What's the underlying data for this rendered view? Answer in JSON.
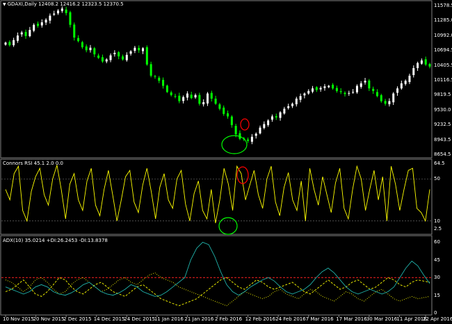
{
  "window": {
    "symbol_label": "GDAXI,Daily",
    "ohlc_label": "12408.2 12416.2 12323.5 12370.5"
  },
  "price_axis": [
    "11578.5",
    "11285.0",
    "10992.0",
    "10694.5",
    "10405.5",
    "10116.5",
    "9819.5",
    "9530.0",
    "9232.5",
    "8943.5",
    "8654.5"
  ],
  "rsi_panel": {
    "title": "Connors RSI 45.1 2.0 0.0",
    "axis": [
      "64.5",
      "50",
      "10",
      "2.5"
    ]
  },
  "adx_panel": {
    "title": "ADX(10) 35.0214 +DI:26.2453 -DI:13.8378",
    "axis": [
      "60",
      "45",
      "30",
      "15",
      "0"
    ]
  },
  "dates": [
    "10 Nov 2015",
    "20 Nov 2015",
    "2 Dec 2015",
    "14 Dec 2015",
    "24 Dec 2015",
    "11 Jan 2016",
    "21 Jan 2016",
    "2 Feb 2016",
    "12 Feb 2016",
    "24 Feb 2016",
    "7 Mar 2016",
    "17 Mar 2016",
    "30 Mar 2016",
    "11 Apr 2016",
    "22 Apr 2016"
  ],
  "colors": {
    "bull": "#ffffff",
    "bear": "#00ff00",
    "rsi": "#ffff00",
    "adx": "#20b2aa",
    "plus_di": "#ffff00",
    "minus_di": "#ffff00",
    "level": "#ff2020",
    "circle_green": "#00ff00",
    "circle_red": "#ff0000"
  },
  "chart_data": {
    "type": "candlestick",
    "closes": [
      10850,
      10800,
      10900,
      10990,
      11050,
      10980,
      11100,
      11200,
      11180,
      11250,
      11300,
      11380,
      11420,
      11480,
      11520,
      11430,
      11200,
      10950,
      10880,
      10760,
      10700,
      10750,
      10620,
      10550,
      10480,
      10520,
      10600,
      10650,
      10580,
      10520,
      10610,
      10680,
      10750,
      10700,
      10740,
      10420,
      10200,
      10180,
      10100,
      10000,
      9880,
      9820,
      9790,
      9700,
      9780,
      9850,
      9760,
      9820,
      9650,
      9680,
      9850,
      9750,
      9650,
      9550,
      9450,
      9400,
      9230,
      9050,
      8960,
      8950,
      8920,
      9000,
      9060,
      9180,
      9250,
      9320,
      9400,
      9380,
      9480,
      9550,
      9600,
      9650,
      9750,
      9800,
      9850,
      9900,
      9950,
      9920,
      9960,
      9990,
      10000,
      9950,
      9900,
      9880,
      9840,
      9860,
      9880,
      10000,
      10050,
      10100,
      9950,
      9900,
      9800,
      9700,
      9650,
      9700,
      9850,
      9950,
      10050,
      10100,
      10200,
      10350,
      10450,
      10500,
      10420,
      10380
    ],
    "rsi": {
      "values": [
        40,
        30,
        55,
        62,
        20,
        10,
        38,
        52,
        60,
        35,
        25,
        50,
        63,
        40,
        12,
        45,
        55,
        30,
        20,
        48,
        60,
        25,
        15,
        40,
        58,
        35,
        10,
        30,
        52,
        58,
        28,
        18,
        44,
        60,
        38,
        12,
        42,
        55,
        30,
        22,
        50,
        58,
        26,
        10,
        36,
        48,
        20,
        12,
        40,
        8,
        30,
        60,
        45,
        20,
        62,
        55,
        30,
        44,
        58,
        35,
        22,
        50,
        62,
        28,
        15,
        42,
        56,
        30,
        20,
        48,
        10,
        60,
        40,
        25,
        52,
        35,
        18,
        46,
        60,
        22,
        12,
        40,
        62,
        50,
        20,
        40,
        58,
        30,
        52,
        10,
        62,
        45,
        20,
        40,
        58,
        60,
        22,
        18,
        10,
        40
      ],
      "levels": [
        10,
        50
      ]
    },
    "adx": {
      "adx": [
        22,
        20,
        18,
        16,
        18,
        22,
        24,
        22,
        18,
        16,
        15,
        17,
        20,
        24,
        26,
        22,
        18,
        16,
        15,
        17,
        20,
        24,
        22,
        18,
        16,
        14,
        15,
        18,
        22,
        26,
        30,
        45,
        55,
        60,
        58,
        48,
        35,
        24,
        18,
        15,
        18,
        22,
        25,
        28,
        30,
        27,
        22,
        18,
        16,
        18,
        20,
        24,
        30,
        35,
        38,
        34,
        28,
        22,
        18,
        16,
        18,
        20,
        18,
        16,
        18,
        22,
        30,
        38,
        44,
        40,
        32,
        25
      ],
      "plus_di": [
        18,
        20,
        24,
        28,
        22,
        16,
        14,
        18,
        24,
        30,
        28,
        22,
        18,
        16,
        20,
        24,
        26,
        22,
        18,
        16,
        14,
        18,
        22,
        24,
        20,
        16,
        12,
        10,
        8,
        6,
        8,
        10,
        12,
        16,
        20,
        24,
        28,
        30,
        26,
        22,
        20,
        24,
        28,
        26,
        22,
        20,
        22,
        24,
        26,
        22,
        18,
        16,
        20,
        24,
        28,
        24,
        20,
        22,
        26,
        28,
        24,
        20,
        22,
        26,
        30,
        28,
        24,
        22,
        26,
        28,
        27,
        26
      ],
      "minus_di": [
        28,
        26,
        22,
        18,
        22,
        28,
        30,
        26,
        20,
        16,
        18,
        24,
        28,
        30,
        26,
        22,
        18,
        20,
        24,
        28,
        30,
        26,
        24,
        28,
        32,
        34,
        30,
        28,
        26,
        22,
        20,
        18,
        16,
        14,
        12,
        10,
        8,
        6,
        10,
        14,
        18,
        16,
        14,
        12,
        14,
        18,
        20,
        16,
        14,
        12,
        16,
        20,
        18,
        14,
        12,
        10,
        14,
        18,
        16,
        12,
        10,
        14,
        18,
        20,
        16,
        12,
        10,
        12,
        14,
        12,
        13,
        14
      ],
      "level": 30
    }
  }
}
